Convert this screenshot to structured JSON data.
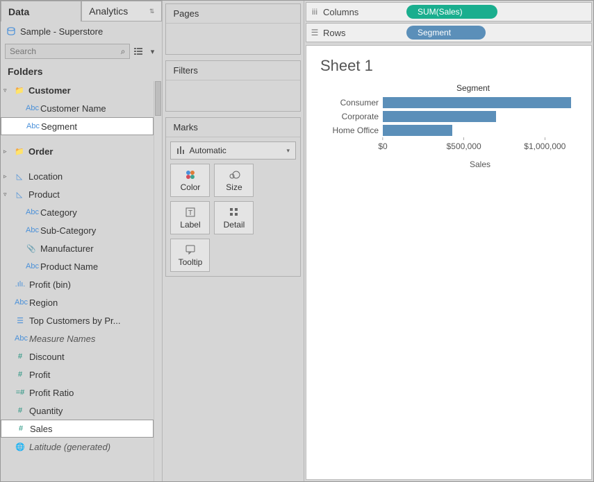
{
  "tabs": {
    "data": "Data",
    "analytics": "Analytics"
  },
  "datasource": "Sample - Superstore",
  "search_placeholder": "Search",
  "folders_label": "Folders",
  "tree": {
    "customer": "Customer",
    "customer_name": "Customer Name",
    "segment": "Segment",
    "order": "Order",
    "location": "Location",
    "product": "Product",
    "category": "Category",
    "sub_category": "Sub-Category",
    "manufacturer": "Manufacturer",
    "product_name": "Product Name",
    "profit_bin": "Profit (bin)",
    "region": "Region",
    "top_customers": "Top Customers by Pr...",
    "measure_names": "Measure Names",
    "discount": "Discount",
    "profit": "Profit",
    "profit_ratio": "Profit Ratio",
    "quantity": "Quantity",
    "sales": "Sales",
    "latitude": "Latitude (generated)"
  },
  "cards": {
    "pages": "Pages",
    "filters": "Filters",
    "marks": "Marks",
    "mark_type": "Automatic",
    "color": "Color",
    "size": "Size",
    "label": "Label",
    "detail": "Detail",
    "tooltip": "Tooltip"
  },
  "shelves": {
    "columns": "Columns",
    "rows": "Rows",
    "columns_pill": "SUM(Sales)",
    "rows_pill": "Segment"
  },
  "sheet_title": "Sheet 1",
  "chart_data": {
    "type": "bar",
    "orientation": "horizontal",
    "title": "Segment",
    "categories": [
      "Consumer",
      "Corporate",
      "Home Office"
    ],
    "values": [
      1160000,
      700000,
      430000
    ],
    "xlabel": "Sales",
    "xlim": [
      0,
      1200000
    ],
    "x_ticks": [
      0,
      500000,
      1000000
    ],
    "x_tick_labels": [
      "$0",
      "$500,000",
      "$1,000,000"
    ],
    "bar_color": "#5b8fb9"
  }
}
